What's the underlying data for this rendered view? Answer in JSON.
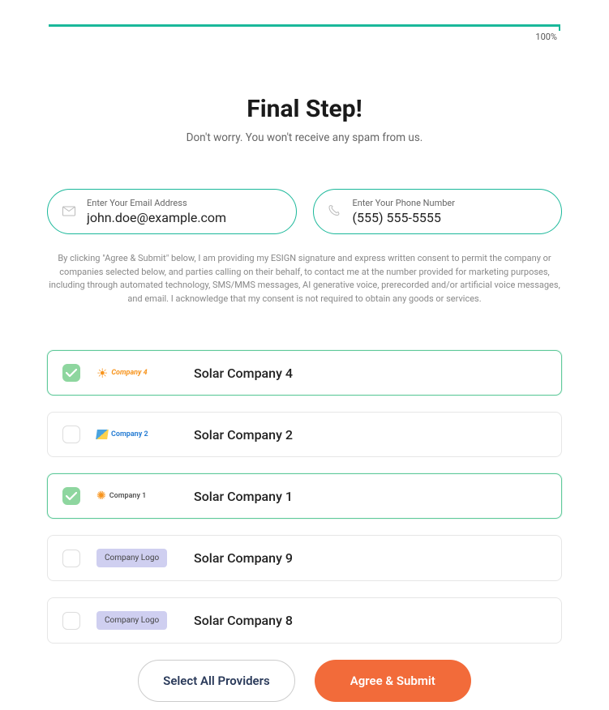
{
  "progress": {
    "label": "100%"
  },
  "heading": {
    "title": "Final Step!",
    "subtitle": "Don't worry. You won't receive any spam from us."
  },
  "inputs": {
    "email": {
      "label": "Enter Your Email Address",
      "value": "john.doe@example.com"
    },
    "phone": {
      "label": "Enter Your Phone Number",
      "value": "(555) 555-5555"
    }
  },
  "consent": "By clicking \"Agree & Submit\" below, I am providing my ESIGN signature and express written consent to permit the company or companies selected below, and parties calling on their behalf, to contact me at the number provided for marketing purposes, including through automated technology, SMS/MMS messages, AI generative voice, prerecorded and/or artificial voice messages, and email. I acknowledge that my consent is not required to obtain any goods or services.",
  "providers": [
    {
      "name": "Solar Company 4",
      "checked": true,
      "logoType": "c4",
      "logoText": "Company 4"
    },
    {
      "name": "Solar Company 2",
      "checked": false,
      "logoType": "c2",
      "logoText": "Company 2"
    },
    {
      "name": "Solar Company 1",
      "checked": true,
      "logoType": "c1",
      "logoText": "Company 1"
    },
    {
      "name": "Solar Company 9",
      "checked": false,
      "logoType": "badge",
      "logoText": "Company Logo"
    },
    {
      "name": "Solar Company 8",
      "checked": false,
      "logoType": "badge",
      "logoText": "Company Logo"
    }
  ],
  "actions": {
    "selectAll": "Select All Providers",
    "submit": "Agree & Submit"
  }
}
